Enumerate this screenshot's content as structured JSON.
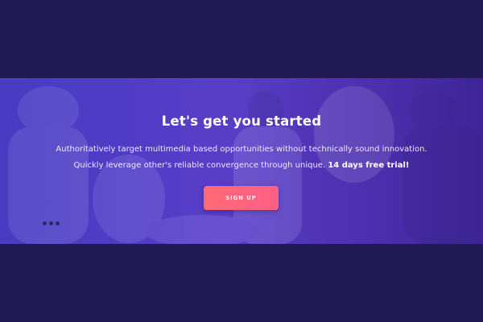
{
  "hero": {
    "heading": "Let's get you started",
    "description_text": "Authoritatively target multimedia based opportunities without technically sound innovation. Quickly leverage other's reliable convergence through unique.",
    "description_highlight": "14 days free trial!",
    "cta_label": "SIGN UP",
    "carousel_dots": 3
  },
  "colors": {
    "page_background": "#1f1a52",
    "banner_gradient_start": "#4a3cc0",
    "banner_gradient_end": "#3e2596",
    "cta_gradient_start": "#ff6a73",
    "cta_gradient_end": "#ff5e86",
    "text": "#ffffff"
  },
  "background_image": "blurred photo of business people in a meeting"
}
